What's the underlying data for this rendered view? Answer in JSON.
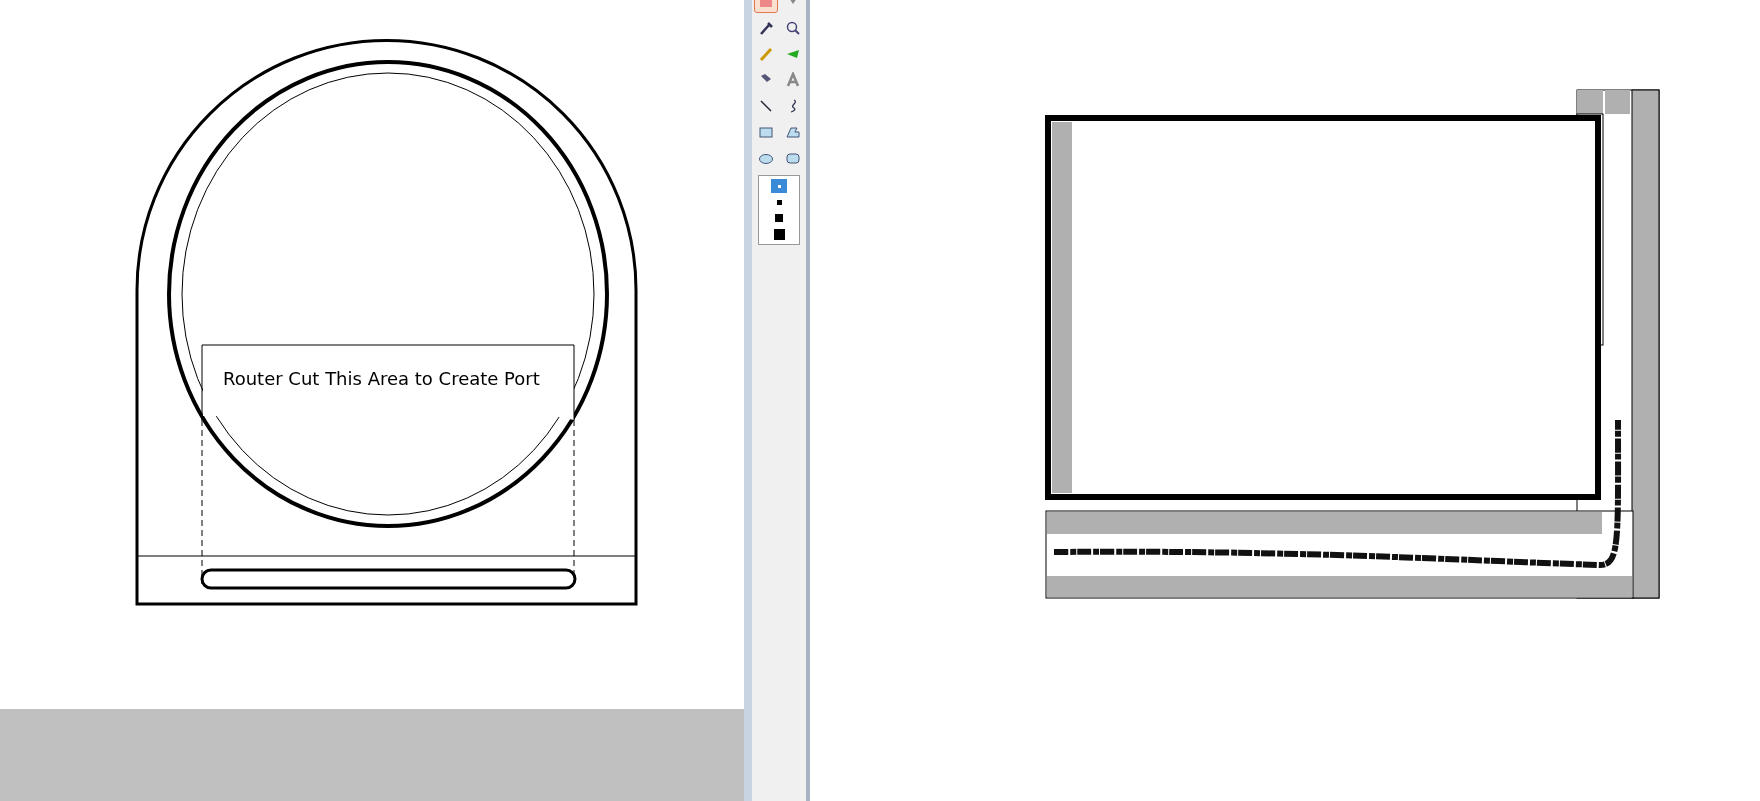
{
  "left_canvas": {
    "label": "Router Cut This Area to Create Port"
  },
  "toolbox": {
    "tools": [
      {
        "selected": true
      },
      {
        "selected": false
      },
      {
        "selected": false
      },
      {
        "selected": false
      },
      {
        "selected": false
      },
      {
        "selected": false
      },
      {
        "selected": false
      },
      {
        "selected": false
      },
      {
        "selected": false
      },
      {
        "selected": false
      },
      {
        "selected": false
      },
      {
        "selected": false
      },
      {
        "selected": false
      },
      {
        "selected": false
      }
    ],
    "line_widths": [
      {
        "selected": true
      },
      {
        "selected": false
      },
      {
        "selected": false
      },
      {
        "selected": false
      }
    ]
  }
}
